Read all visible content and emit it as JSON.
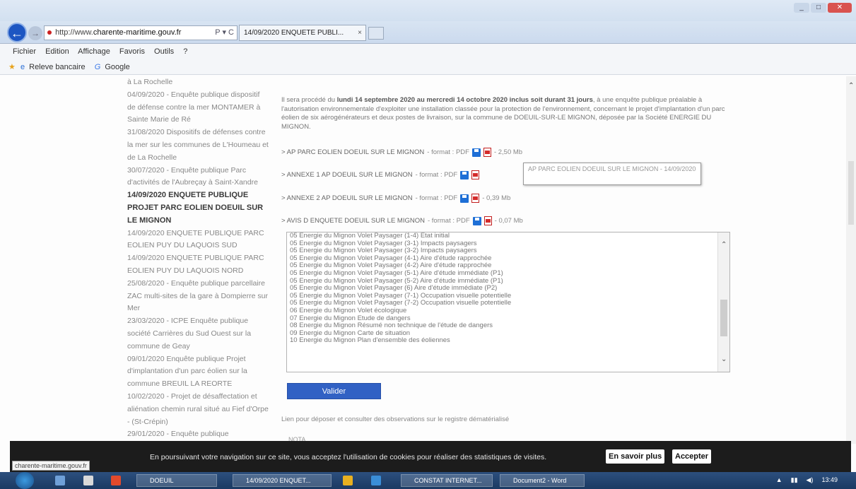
{
  "browser": {
    "address_prefix": "http://www.",
    "address_domain": "charente-maritime.gouv.fr",
    "address_controls": "P ▾ C",
    "tab_title": "14/09/2020 ENQUETE PUBLI...",
    "tab_close": "×",
    "menu": [
      "Fichier",
      "Edition",
      "Affichage",
      "Favoris",
      "Outils",
      "?"
    ],
    "favorites": {
      "item1": "Releve bancaire",
      "item2": "Google"
    }
  },
  "sidebar": {
    "items": [
      {
        "text": "à La Rochelle"
      },
      {
        "text": "04/09/2020 - Enquête publique dispositif de défense contre la mer MONTAMER à Sainte Marie de Ré"
      },
      {
        "text": "31/08/2020 Dispositifs de défenses contre la mer sur les communes de L'Houmeau et de La Rochelle"
      },
      {
        "text": "30/07/2020 - Enquête publique Parc d'activités de l'Aubreçay à Saint-Xandre"
      },
      {
        "text": "14/09/2020 ENQUETE PUBLIQUE PROJET PARC EOLIEN DOEUIL SUR LE MIGNON"
      },
      {
        "text": "14/09/2020 ENQUETE PUBLIQUE PARC EOLIEN PUY DU LAQUOIS SUD"
      },
      {
        "text": "14/09/2020 ENQUETE PUBLIQUE PARC EOLIEN PUY DU LAQUOIS NORD"
      },
      {
        "text": "25/08/2020 - Enquête publique parcellaire ZAC multi-sites de la gare à Dompierre sur Mer"
      },
      {
        "text": "23/03/2020 - ICPE Enquête publique société Carrières du Sud Ouest sur la commune de Geay"
      },
      {
        "text": "09/01/2020 Enquête publique Projet d'implantation d'un parc éolien sur la commune BREUIL LA REORTE"
      },
      {
        "text": "10/02/2020 - Projet de désaffectation et aliénation chemin rural situé au Fief d'Orpe - (St-Crépin)"
      },
      {
        "text": "29/01/2020 - Enquête publique"
      }
    ]
  },
  "main": {
    "intro_before": "Il sera procédé du ",
    "intro_bold": "lundi 14 septembre 2020 au mercredi 14 octobre 2020 inclus soit durant 31 jours",
    "intro_after": ", à une enquête publique préalable à l'autorisation environnementale d'exploiter une installation classée pour la protection de l'environnement, concernant le projet d'implantation d'un parc éolien de six aérogénérateurs et deux postes de livraison, sur la commune de DOEUIL-SUR-LE MIGNON, déposée par la Société ENERGIE DU MIGNON.",
    "docs": [
      {
        "name": "> AP PARC EOLIEN DOEUIL SUR LE MIGNON",
        "format": "- format : PDF",
        "size": "- 2,50 Mb"
      },
      {
        "name": "> ANNEXE 1 AP DOEUIL SUR LE MIGNON",
        "format": "- format : PDF",
        "size": ""
      },
      {
        "name": "> ANNEXE 2 AP DOEUIL SUR LE MIGNON",
        "format": "- format : PDF",
        "size": "- 0,39 Mb"
      },
      {
        "name": "> AVIS D ENQUETE DOEUIL SUR LE MIGNON",
        "format": "- format : PDF",
        "size": "- 0,07 Mb"
      }
    ],
    "tooltip": "AP PARC EOLIEN DOEUIL SUR LE MIGNON - 14/09/2020",
    "list_options": [
      "05 Energie du Mignon Volet Paysager (1-4) Etat initial",
      "05 Energie du Mignon Volet Paysager (3-1) Impacts paysagers",
      "05 Energie du Mignon Volet Paysager (3-2) Impacts paysagers",
      "05 Energie du Mignon Volet Paysager (4-1) Aire d'étude rapprochée",
      "05 Energie du Mignon Volet Paysager (4-2) Aire d'étude rapprochée",
      "05 Energie du Mignon Volet Paysager (5-1) Aire d'étude immédiate (P1)",
      "05 Energie du Mignon Volet Paysager (5-2) Aire d'étude immédiate (P1)",
      "05 Energie du Mignon Volet Paysager (6) Aire d'étude immédiate (P2)",
      "05 Energie du Mignon Volet Paysager (7-1) Occupation visuelle potentielle",
      "05 Energie du Mignon Volet Paysager (7-2) Occupation visuelle potentielle",
      "06 Energie du Mignon Volet écologique",
      "07 Energie du Mignon Etude de dangers",
      "08 Energie du Mignon Résumé non technique de l'étude de dangers",
      "09 Energie du Mignon Carte de situation",
      "10 Energie du Mignon Plan d'ensemble des éoliennes"
    ],
    "valider": "Valider",
    "observations": "Lien pour déposer et consulter des observations sur le registre dématérialisé",
    "nota": "NOTA"
  },
  "cookie": {
    "text": "En poursuivant votre navigation sur ce site, vous acceptez l'utilisation de cookies pour réaliser des statistiques de visites.",
    "more": "En savoir plus",
    "accept": "Accepter"
  },
  "status_url": "charente-maritime.gouv.fr",
  "taskbar": {
    "tasks": [
      "DOEUIL",
      "14/09/2020 ENQUET...",
      "CONSTAT INTERNET...",
      "Document2 - Word"
    ],
    "clock": "13:49"
  }
}
